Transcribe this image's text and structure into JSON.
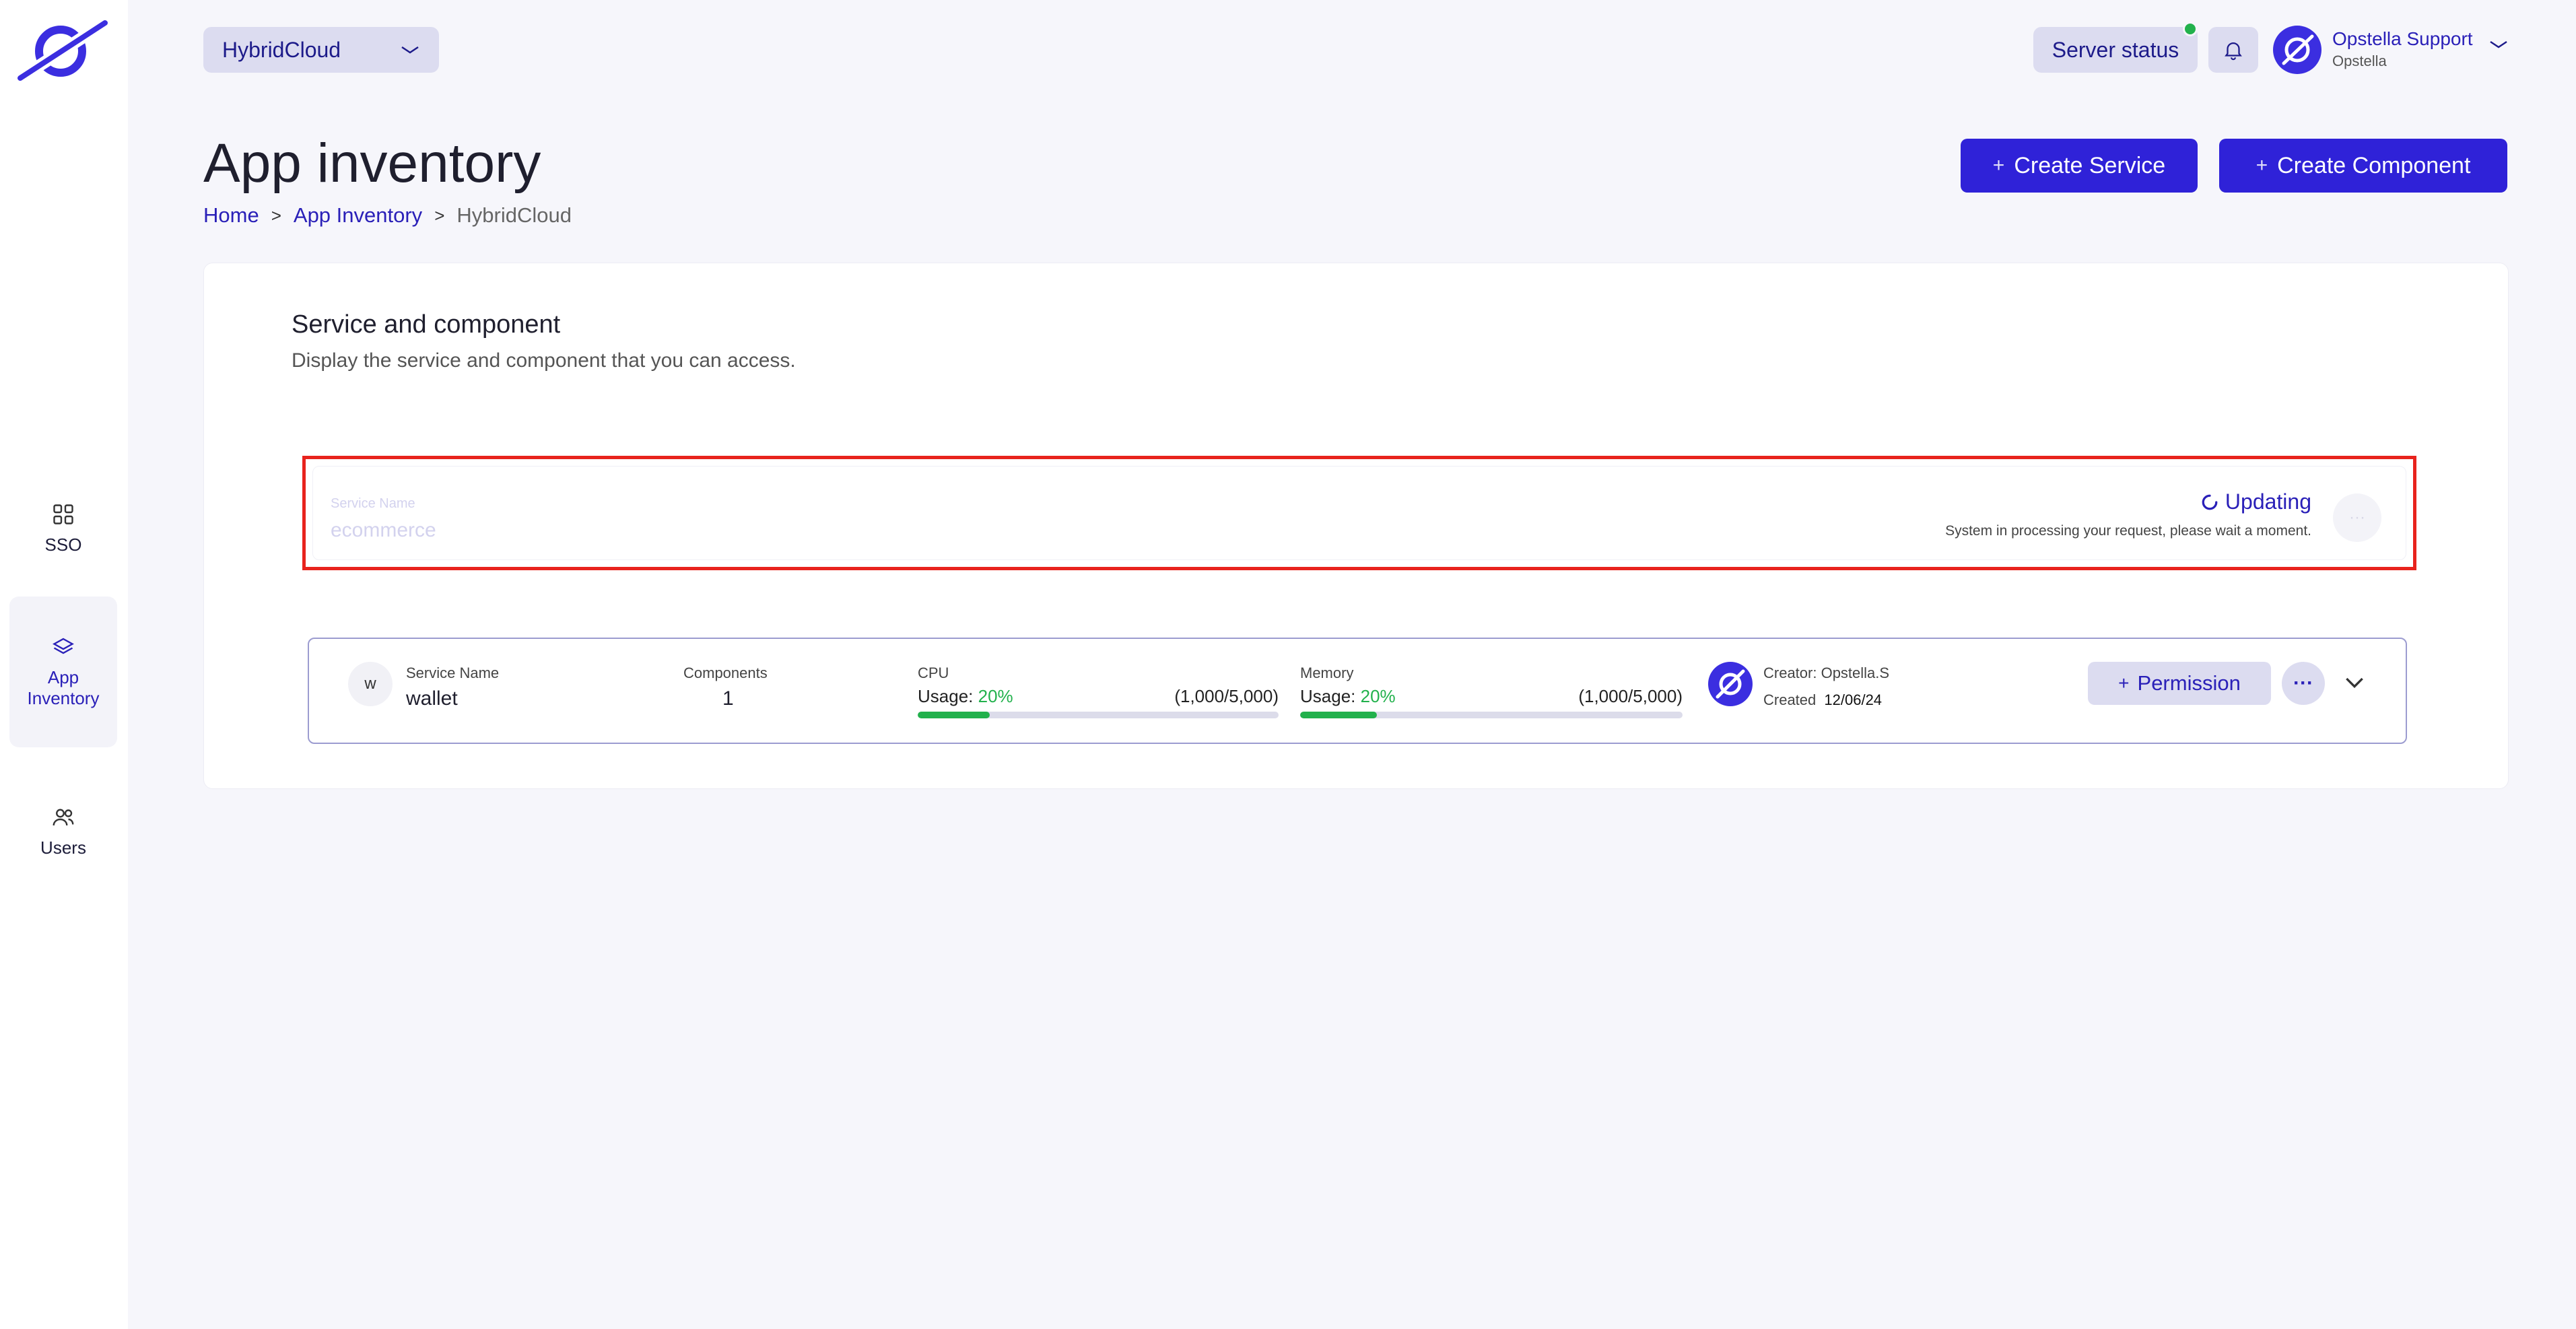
{
  "sidebar": {
    "items": [
      {
        "label": "SSO",
        "icon": "grid-icon"
      },
      {
        "label": "App Inventory",
        "icon": "layers-icon",
        "active": true
      },
      {
        "label": "Users",
        "icon": "users-icon"
      }
    ]
  },
  "header": {
    "project_select": "HybridCloud",
    "server_status": "Server status",
    "user_name": "Opstella Support",
    "user_org": "Opstella"
  },
  "page": {
    "title": "App inventory",
    "breadcrumb": [
      "Home",
      "App Inventory",
      "HybridCloud"
    ],
    "create_service": "Create Service",
    "create_component": "Create Component"
  },
  "card": {
    "title": "Service and component",
    "subtitle": "Display the service and component that you can access."
  },
  "updating_row": {
    "label": "Service Name",
    "value": "ecommerce",
    "status": "Updating",
    "message": "System in processing your request, please wait a moment.",
    "more": "···"
  },
  "service_row": {
    "avatar_letter": "w",
    "name_label": "Service Name",
    "name": "wallet",
    "components_label": "Components",
    "components": "1",
    "cpu_label": "CPU",
    "cpu_usage_label": "Usage:",
    "cpu_pct": "20%",
    "cpu_ratio": "(1,000/5,000)",
    "cpu_fill": 0.2,
    "memory_label": "Memory",
    "memory_usage_label": "Usage:",
    "memory_pct": "20%",
    "memory_ratio": "(1,000/5,000)",
    "memory_fill": 0.2,
    "creator": "Creator: Opstella.S",
    "created_label": "Created",
    "created_date": "12/06/24",
    "permission": "Permission",
    "more": "···"
  },
  "colors": {
    "accent": "#2f22d8",
    "link": "#2a20b8",
    "success": "#22b14c",
    "highlight": "#e8231d"
  }
}
